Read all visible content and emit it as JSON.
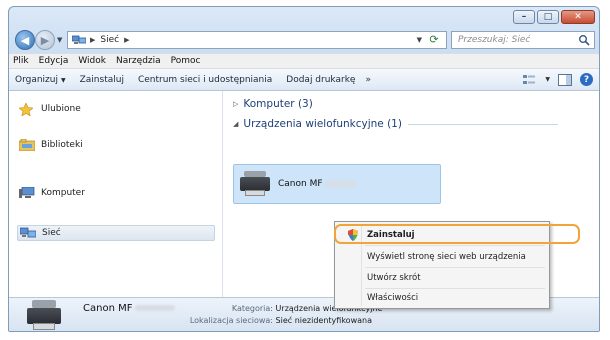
{
  "address": {
    "crumbs": [
      "Sieć"
    ],
    "search_placeholder": "Przeszukaj: Sieć"
  },
  "menu": [
    "Plik",
    "Edycja",
    "Widok",
    "Narzędzia",
    "Pomoc"
  ],
  "commandbar": {
    "organize": "Organizuj",
    "install": "Zainstaluj",
    "network_center": "Centrum sieci i udostępniania",
    "add_printer": "Dodaj drukarkę",
    "more": "»"
  },
  "nav": {
    "favorites": "Ulubione",
    "libraries": "Biblioteki",
    "computer": "Komputer",
    "network": "Sieć"
  },
  "groups": {
    "computer": "Komputer (3)",
    "multifunction": "Urządzenia wielofunkcyjne (1)"
  },
  "device": {
    "name": "Canon MF"
  },
  "context_menu": {
    "install": "Zainstaluj",
    "web_page": "Wyświetl stronę sieci web urządzenia",
    "shortcut": "Utwórz skrót",
    "properties": "Właściwości"
  },
  "details": {
    "name": "Canon MF",
    "category_label": "Kategoria:",
    "category_value": "Urządzenia wielofunkcyjne",
    "location_label": "Lokalizacja sieciowa:",
    "location_value": "Sieć niezidentyfikowana"
  },
  "colors": {
    "highlight": "#f0a43a",
    "selection": "#cde4f9"
  }
}
